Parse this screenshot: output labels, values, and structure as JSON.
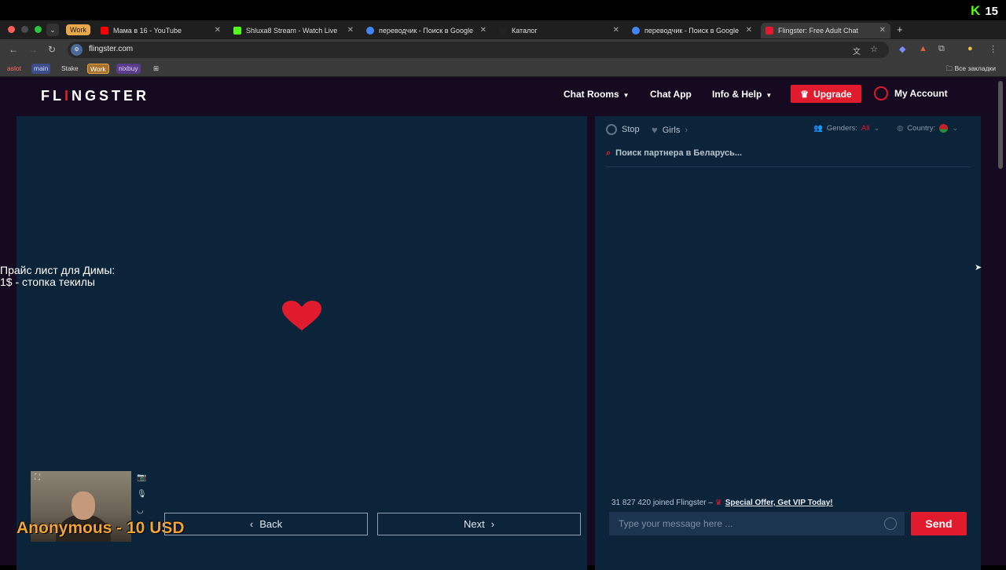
{
  "overlay": {
    "kick_logo": "K",
    "viewers": "15"
  },
  "browser": {
    "group_label": "Work",
    "tabs": [
      {
        "title": "Мама в 16 - YouTube",
        "favicon_color": "#ff0000"
      },
      {
        "title": "Shluxa8 Stream - Watch Live",
        "favicon_color": "#53fc18"
      },
      {
        "title": "переводчик - Поиск в Google",
        "favicon_color": "#4285f4"
      },
      {
        "title": "Каталог",
        "favicon_color": "#222222"
      },
      {
        "title": "переводчик - Поиск в Google",
        "favicon_color": "#4285f4"
      },
      {
        "title": "Flingster: Free Adult Chat",
        "favicon_color": "#e01b2e"
      }
    ],
    "url": "flingster.com",
    "bookmarks": [
      "aslot",
      "main",
      "Stake",
      "Work",
      "nixbuy"
    ],
    "all_bookmarks": "Все закладки"
  },
  "site": {
    "logo_pre": "FL",
    "logo_i": "I",
    "logo_post": "NGSTER",
    "menu": {
      "chat_rooms": "Chat Rooms",
      "chat_app": "Chat App",
      "info_help": "Info & Help",
      "upgrade": "Upgrade",
      "my_account": "My Account"
    }
  },
  "video": {
    "price_line1": "Прайс лист для Димы:",
    "price_line2": "1$ - стопка текилы",
    "donation": "Anonymous - 10 USD",
    "back": "Back",
    "next": "Next"
  },
  "chat": {
    "stop": "Stop",
    "girls": "Girls",
    "genders_label": "Genders:",
    "genders_value": "All",
    "country_label": "Country:",
    "searching": "Поиск партнера в Беларусь...",
    "joined": "31 827 420 joined Flingster –",
    "offer": "Special Offer, Get VIP Today!",
    "message_placeholder": "Type your message here ...",
    "send": "Send"
  },
  "colors": {
    "accent": "#e01b2e",
    "panel": "#0c2439",
    "page_bg": "#160a21"
  }
}
